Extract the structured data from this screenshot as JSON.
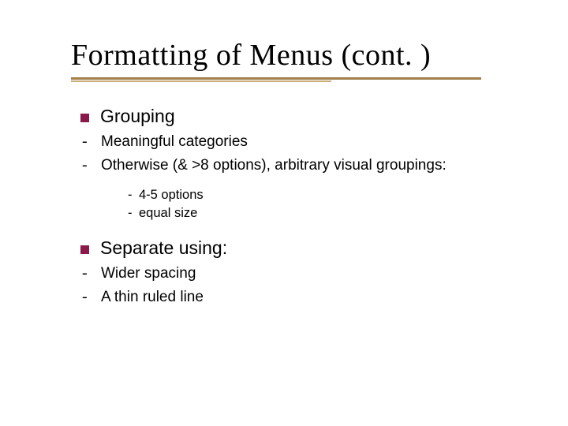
{
  "title": "Formatting of Menus (cont. )",
  "sections": [
    {
      "heading": "Grouping",
      "items": [
        "Meaningful categories",
        "Otherwise (& >8 options), arbitrary visual groupings:"
      ],
      "subitems": [
        "4-5 options",
        "equal size"
      ]
    },
    {
      "heading": "Separate using:",
      "items": [
        "Wider spacing",
        "A thin ruled line"
      ],
      "subitems": []
    }
  ]
}
